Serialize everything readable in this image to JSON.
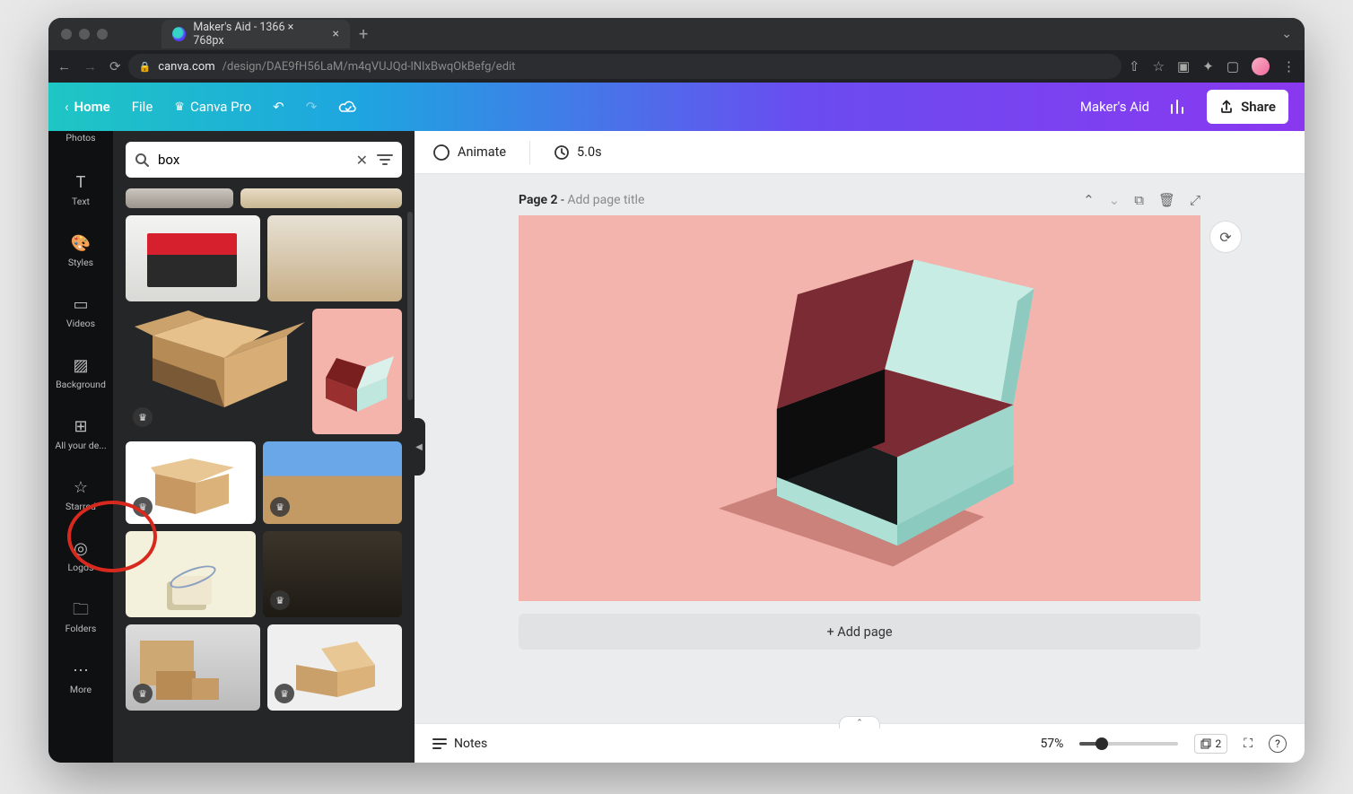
{
  "browser": {
    "tab_title": "Maker's Aid - 1366 × 768px",
    "url_host": "canva.com",
    "url_path": "/design/DAE9fH56LaM/m4qVUJQd-lNIxBwqOkBefg/edit"
  },
  "canva_top": {
    "home": "Home",
    "file": "File",
    "pro": "Canva Pro",
    "project_name": "Maker's Aid",
    "share": "Share"
  },
  "rail": {
    "items": [
      {
        "label": "Photos"
      },
      {
        "label": "Text"
      },
      {
        "label": "Styles"
      },
      {
        "label": "Videos"
      },
      {
        "label": "Background"
      },
      {
        "label": "All your de..."
      },
      {
        "label": "Starred"
      },
      {
        "label": "Logos"
      },
      {
        "label": "Folders"
      },
      {
        "label": "More"
      }
    ]
  },
  "search": {
    "value": "box"
  },
  "page": {
    "label": "Page 2",
    "sep": " - ",
    "add_title": "Add page title",
    "add_page": "+ Add page"
  },
  "tools": {
    "animate": "Animate",
    "duration": "5.0s"
  },
  "bottom": {
    "notes": "Notes",
    "zoom": "57%",
    "page_count": "2"
  }
}
